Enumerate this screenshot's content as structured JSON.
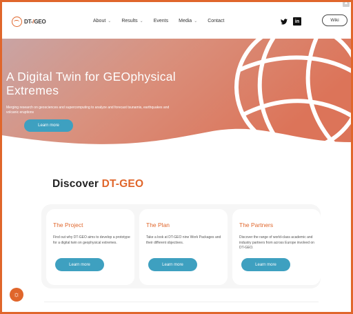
{
  "header": {
    "logo": {
      "prefix": "DT-",
      "slash": "/",
      "suffix": "GEO"
    },
    "nav": [
      {
        "label": "About",
        "dropdown": true
      },
      {
        "label": "Results",
        "dropdown": true
      },
      {
        "label": "Events",
        "dropdown": false
      },
      {
        "label": "Media",
        "dropdown": true
      },
      {
        "label": "Contact",
        "dropdown": false
      }
    ],
    "social": {
      "twitter_icon": "twitter-icon",
      "linkedin_glyph": "in"
    },
    "wiki_label": "Wiki"
  },
  "hero": {
    "title": "A Digital Twin for GEOphysical Extremes",
    "subtitle": "Merging research on geosciences and supercomputing to analyze and forecast tsunamis, earthquakes and volcanic eruptions",
    "button_label": "Learn more"
  },
  "discover": {
    "prefix": "Discover ",
    "accent": "DT-GEO"
  },
  "cards": [
    {
      "title": "The Project",
      "text": "Find out why DT-GEO aims to develop a prototype for a digital twin on geophysical extremes.",
      "button": "Learn more"
    },
    {
      "title": "The Plan",
      "text": "Take a look at DT-GEO nine Work Packages and their different objectives.",
      "button": "Learn more"
    },
    {
      "title": "The Partners",
      "text": "Discover the range of world-class academic and industry partners from across Europe involved on DT-GEO.",
      "button": "Learn more"
    }
  ],
  "colors": {
    "accent": "#e0662b",
    "button": "#3ea0c0"
  },
  "icons": {
    "fab": "cookie-icon",
    "scroll_top": "scroll-top-icon"
  }
}
